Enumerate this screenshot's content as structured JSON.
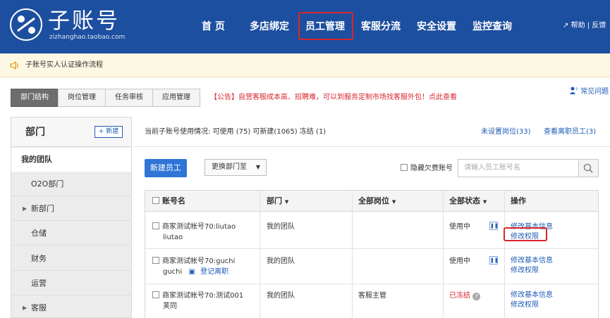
{
  "header": {
    "logo_title": "子账号",
    "logo_subtitle": "zizhanghao.taobao.com",
    "nav": [
      "首 页",
      "多店绑定",
      "员工管理",
      "客服分流",
      "安全设置",
      "监控查询"
    ],
    "help": "帮助 | 反馈"
  },
  "notice": {
    "text": "子账号实人认证操作流程"
  },
  "tabs": [
    "部门结构",
    "岗位管理",
    "任务审核",
    "应用管理"
  ],
  "announcement": "【公告】自营客服成本高、招聘难，可以到服务定制市场找客服外包！点此查看",
  "faq": "常见问题",
  "sidebar": {
    "title": "部门",
    "new_button": "+ 新建",
    "team": "我的团队",
    "items": [
      "O2O部门",
      "新部门",
      "仓储",
      "财务",
      "运营",
      "客服"
    ]
  },
  "info": {
    "usage": "当前子账号使用情况:  可使用 (75)    可新建(1065)    冻结 (1)",
    "unset_post": "未设置岗位(33)",
    "view_left": "查看离职员工(3)"
  },
  "toolbar": {
    "new_employee": "新建员工",
    "change_dept": "更换部门至",
    "hide_overdue": "隐藏欠费账号",
    "search_placeholder": "请输入员工账号名"
  },
  "table": {
    "headers": [
      "账号名",
      "部门",
      "全部岗位",
      "全部状态",
      "操作"
    ],
    "rows": [
      {
        "account": "商家测试帐号70:liutao",
        "account2": "liutao",
        "dept": "我的团队",
        "post": "",
        "status": "使用中",
        "op1": "修改基本信息",
        "op2": "修改权限"
      },
      {
        "account": "商家测试帐号70:guchi",
        "account2": "guchi",
        "extra": "登记离职",
        "dept": "我的团队",
        "post": "",
        "status": "使用中",
        "op1": "修改基本信息",
        "op2": "修改权限"
      },
      {
        "account": "商家测试帐号70:测试001",
        "account2": "芙同",
        "dept": "我的团队",
        "post": "客服主管",
        "status": "已冻结",
        "op1": "修改基本信息",
        "op2": "修改权限"
      }
    ]
  },
  "colors": {
    "header_bg": "#1d4fa0",
    "accent_blue": "#2f75d6",
    "alert_red": "#d9262c",
    "link_blue": "#1d5bb5"
  }
}
